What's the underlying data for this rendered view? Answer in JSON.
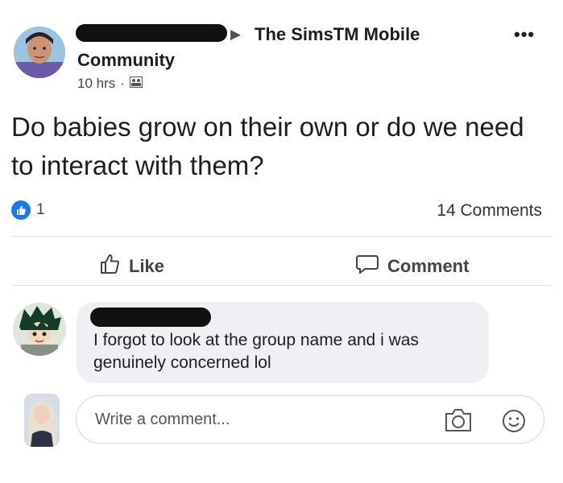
{
  "post": {
    "group_name": "The SimsTM Mobile",
    "community_label": "Community",
    "time": "10 hrs",
    "separator": "·",
    "text": "Do babies grow on their own or do we need to interact with them?",
    "like_count": "1",
    "comments_count": "14 Comments"
  },
  "actions": {
    "like_label": "Like",
    "comment_label": "Comment"
  },
  "comment": {
    "text": "I forgot to look at the group name and i was genuinely concerned lol"
  },
  "composer": {
    "placeholder": "Write a comment..."
  },
  "colors": {
    "like_blue": "#1877f2",
    "bubble_bg": "#eff0f3"
  },
  "icons": [
    "more-options-icon",
    "privacy-group-icon",
    "thumbs-up-icon",
    "comment-bubble-icon",
    "camera-icon",
    "smiley-icon"
  ]
}
